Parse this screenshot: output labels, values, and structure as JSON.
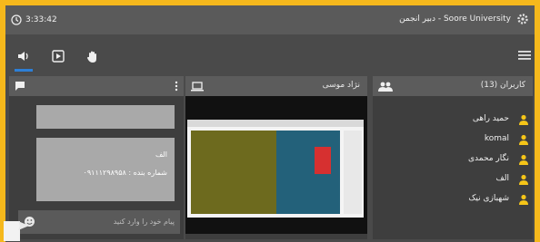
{
  "header": {
    "time": "3:33:42",
    "title": "Soore University - دبیر انجمن"
  },
  "toolbar": {
    "icons": [
      "speaker-icon",
      "play-icon",
      "hand-icon",
      "menu-icon"
    ]
  },
  "chat": {
    "message": {
      "sender": "الف",
      "text": "شماره بنده : ۰۹۱۱۱۲۹۸۹۵۸"
    },
    "input_placeholder": "پیام خود را وارد کنید"
  },
  "video": {
    "title": "نژاد موسی"
  },
  "users": {
    "title": "کاربران (13)",
    "items": [
      {
        "name": "..."
      },
      {
        "name": "حمید راهی"
      },
      {
        "name": "komal"
      },
      {
        "name": "نگار محمدی"
      },
      {
        "name": "الف"
      },
      {
        "name": "شهبازی نیک"
      }
    ]
  },
  "colors": {
    "accent": "#2d7fd6",
    "user_icon": "#f5c518",
    "border": "#f5b81c"
  }
}
